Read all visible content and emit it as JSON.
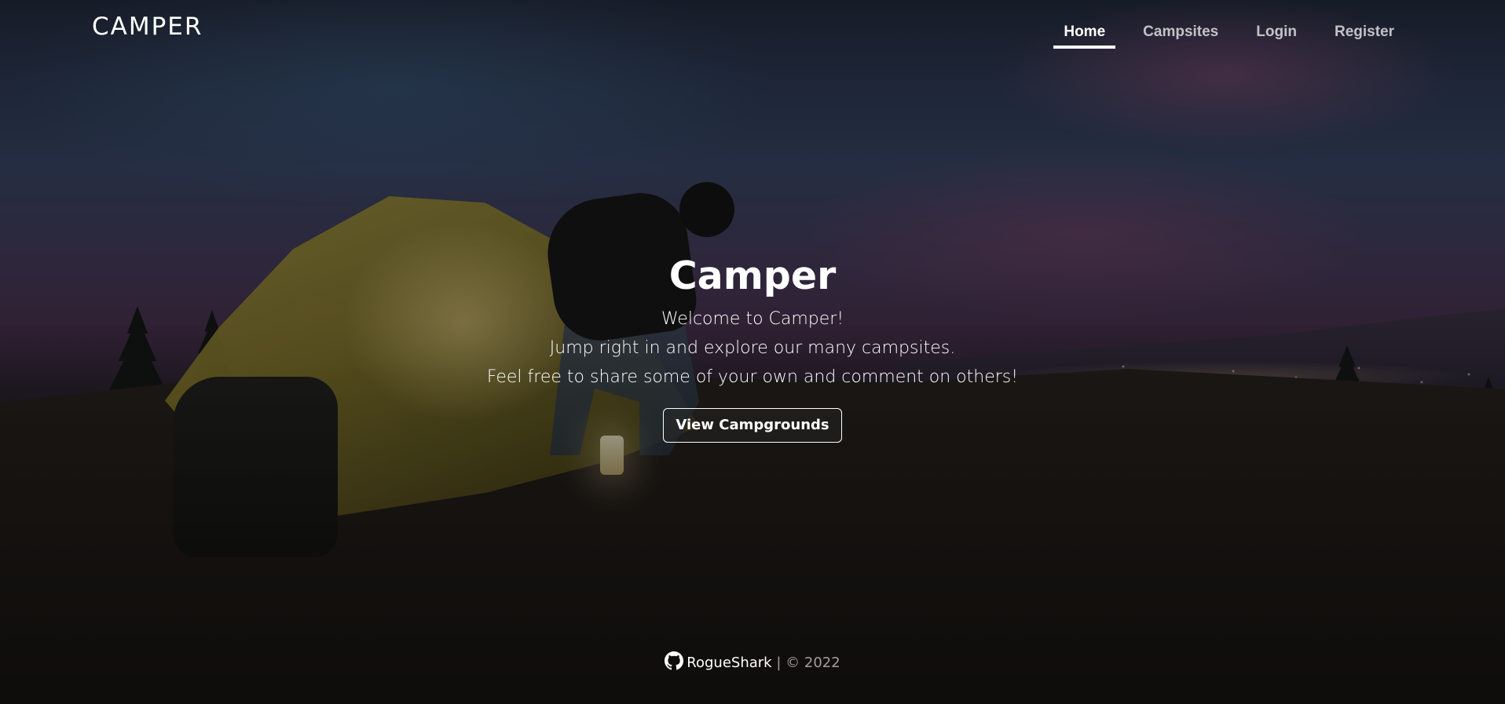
{
  "brand": "CAMPER",
  "nav": {
    "items": [
      {
        "label": "Home",
        "active": true
      },
      {
        "label": "Campsites",
        "active": false
      },
      {
        "label": "Login",
        "active": false
      },
      {
        "label": "Register",
        "active": false
      }
    ]
  },
  "hero": {
    "title": "Camper",
    "lines": [
      "Welcome to Camper!",
      "Jump right in and explore our many campsites.",
      "Feel free to share some of your own and comment on others!"
    ],
    "button_label": "View Campgrounds"
  },
  "footer": {
    "icon": "github-icon",
    "author": "RogueShark",
    "separator": "|",
    "copyright": "© 2022"
  }
}
